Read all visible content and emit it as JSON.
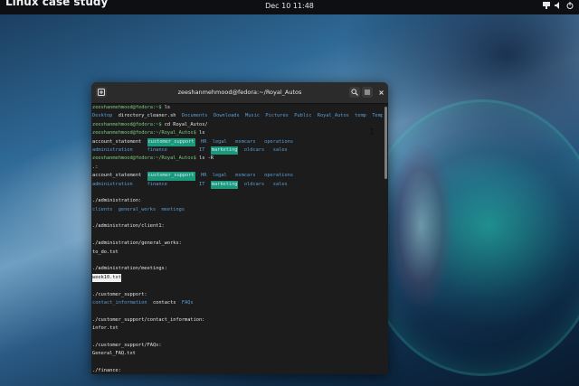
{
  "topbar": {
    "activities": "Linux case study",
    "clock": "Dec 10  11:48"
  },
  "terminal": {
    "title": "zeeshanmehmood@fedora:~/Royal_Autos",
    "lines": [
      [
        {
          "t": "zeeshanmehmood@fedora:~$ ",
          "c": "p"
        },
        {
          "t": "ls",
          "c": "w"
        }
      ],
      [
        {
          "t": "Desktop  ",
          "c": "d"
        },
        {
          "t": "directory_cleaner.sh  ",
          "c": "w"
        },
        {
          "t": "Documents  Downloads  Music  Pictures  Public  Royal_Autos  temp  Templates  Videos",
          "c": "d"
        }
      ],
      [
        {
          "t": "zeeshanmehmood@fedora:~$ ",
          "c": "p"
        },
        {
          "t": "cd Royal_Autos/",
          "c": "w"
        }
      ],
      [
        {
          "t": "zeeshanmehmood@fedora:~/Royal_Autos$ ",
          "c": "p"
        },
        {
          "t": "ls",
          "c": "w"
        }
      ],
      [
        {
          "t": "account_statement  ",
          "c": "w"
        },
        {
          "t": "customer_support",
          "c": "hl"
        },
        {
          "t": "  HR  ",
          "c": "d"
        },
        {
          "t": "legal   ",
          "c": "d"
        },
        {
          "t": "msmcars   ",
          "c": "d"
        },
        {
          "t": "operations",
          "c": "d"
        }
      ],
      [
        {
          "t": "administration     ",
          "c": "d"
        },
        {
          "t": "finance           ",
          "c": "d"
        },
        {
          "t": "IT  ",
          "c": "d"
        },
        {
          "t": "marketing",
          "c": "hl"
        },
        {
          "t": "  oldcars   ",
          "c": "d"
        },
        {
          "t": "sales",
          "c": "d"
        }
      ],
      [
        {
          "t": "zeeshanmehmood@fedora:~/Royal_Autos$ ",
          "c": "p"
        },
        {
          "t": "ls -R",
          "c": "w"
        }
      ],
      [
        {
          "t": ".:",
          "c": "w"
        }
      ],
      [
        {
          "t": "account_statement  ",
          "c": "w"
        },
        {
          "t": "customer_support",
          "c": "hl"
        },
        {
          "t": "  HR  ",
          "c": "d"
        },
        {
          "t": "legal   ",
          "c": "d"
        },
        {
          "t": "msmcars   ",
          "c": "d"
        },
        {
          "t": "operations",
          "c": "d"
        }
      ],
      [
        {
          "t": "administration     ",
          "c": "d"
        },
        {
          "t": "finance           ",
          "c": "d"
        },
        {
          "t": "IT  ",
          "c": "d"
        },
        {
          "t": "marketing",
          "c": "hl"
        },
        {
          "t": "  oldcars   ",
          "c": "d"
        },
        {
          "t": "sales",
          "c": "d"
        }
      ],
      [
        {
          "t": "",
          "c": "w"
        }
      ],
      [
        {
          "t": "./administration:",
          "c": "w"
        }
      ],
      [
        {
          "t": "clients  general_works  meetings",
          "c": "d"
        }
      ],
      [
        {
          "t": "",
          "c": "w"
        }
      ],
      [
        {
          "t": "./administration/client1:",
          "c": "w"
        }
      ],
      [
        {
          "t": "",
          "c": "w"
        }
      ],
      [
        {
          "t": "./administration/general_works:",
          "c": "w"
        }
      ],
      [
        {
          "t": "to_do.txt",
          "c": "w"
        }
      ],
      [
        {
          "t": "",
          "c": "w"
        }
      ],
      [
        {
          "t": "./administration/meetings:",
          "c": "w"
        }
      ],
      [
        {
          "t": "week10.txt",
          "c": "sel"
        }
      ],
      [
        {
          "t": "",
          "c": "w"
        }
      ],
      [
        {
          "t": "./customer_support:",
          "c": "w"
        }
      ],
      [
        {
          "t": "contact_information  ",
          "c": "d"
        },
        {
          "t": "contacts  ",
          "c": "w"
        },
        {
          "t": "FAQs",
          "c": "d"
        }
      ],
      [
        {
          "t": "",
          "c": "w"
        }
      ],
      [
        {
          "t": "./customer_support/contact_information:",
          "c": "w"
        }
      ],
      [
        {
          "t": "infor.txt",
          "c": "w"
        }
      ],
      [
        {
          "t": "",
          "c": "w"
        }
      ],
      [
        {
          "t": "./customer_support/FAQs:",
          "c": "w"
        }
      ],
      [
        {
          "t": "General_FAQ.txt",
          "c": "w"
        }
      ],
      [
        {
          "t": "",
          "c": "w"
        }
      ],
      [
        {
          "t": "./finance:",
          "c": "w"
        }
      ]
    ]
  },
  "icons": {
    "new_tab": "new-tab-icon",
    "search": "search-icon",
    "menu": "hamburger-menu-icon",
    "close": "close-icon"
  },
  "colors": {
    "prompt": "#7ec97e",
    "directory": "#5a9fd8",
    "highlight_dir": "#1a9a7a",
    "terminal_bg": "#1c1c1c"
  }
}
